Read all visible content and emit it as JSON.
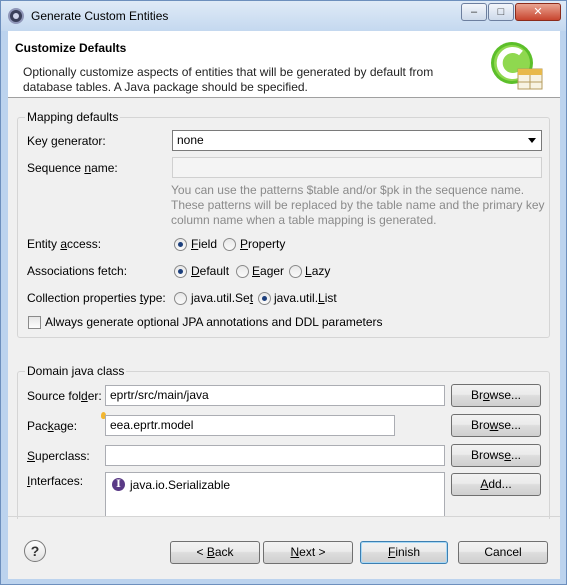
{
  "window": {
    "title": "Generate Custom Entities",
    "controls": {
      "minimize": "–",
      "maximize": "□",
      "close": "✕"
    }
  },
  "banner": {
    "title": "Customize Defaults",
    "description": "Optionally customize aspects of entities that will be generated by default from database tables. A Java package should be specified."
  },
  "mapping": {
    "group_label": "Mapping defaults",
    "key_generator": {
      "label_pre": "Key ",
      "label_u": "g",
      "label_post": "enerator:",
      "value": "none"
    },
    "sequence_name": {
      "label_pre": "Sequence ",
      "label_u": "n",
      "label_post": "ame:",
      "value": ""
    },
    "sequence_hint": "You can use the patterns $table and/or $pk in the sequence name. These patterns will be replaced by the table name and the primary key column name when a table mapping is generated.",
    "entity_access": {
      "label_pre": "Entity ",
      "label_u": "a",
      "label_post": "ccess:",
      "options": [
        {
          "pre": "",
          "u": "F",
          "post": "ield",
          "selected": true
        },
        {
          "pre": "",
          "u": "P",
          "post": "roperty",
          "selected": false
        }
      ]
    },
    "associations_fetch": {
      "label_pre": "Associations fetch:",
      "label_u": "",
      "label_post": "",
      "options": [
        {
          "pre": "",
          "u": "D",
          "post": "efault",
          "selected": true
        },
        {
          "pre": "",
          "u": "E",
          "post": "ager",
          "selected": false
        },
        {
          "pre": "",
          "u": "L",
          "post": "azy",
          "selected": false
        }
      ]
    },
    "collection_type": {
      "label_pre": "Collection properties ",
      "label_u": "t",
      "label_post": "ype:",
      "options": [
        {
          "pre": "java.util.Se",
          "u": "t",
          "post": "",
          "selected": false
        },
        {
          "pre": "java.util.",
          "u": "L",
          "post": "ist",
          "selected": true
        }
      ]
    },
    "always_generate": {
      "label_pre": "Always generate optional JPA annotations and DDL parameters",
      "checked": false
    }
  },
  "domain": {
    "group_label": "Domain java class",
    "source_folder": {
      "label_pre": "Source fol",
      "label_u": "d",
      "label_post": "er:",
      "value": "eprtr/src/main/java",
      "button_pre": "Br",
      "button_u": "o",
      "button_post": "wse..."
    },
    "package": {
      "label_pre": "Pac",
      "label_u": "k",
      "label_post": "age:",
      "value": "eea.eprtr.model",
      "button_pre": "Bro",
      "button_u": "w",
      "button_post": "se..."
    },
    "superclass": {
      "label_pre": "",
      "label_u": "S",
      "label_post": "uperclass:",
      "value": "",
      "button_pre": "Brows",
      "button_u": "e",
      "button_post": "..."
    },
    "interfaces": {
      "label_pre": "",
      "label_u": "I",
      "label_post": "nterfaces:",
      "items": [
        "java.io.Serializable"
      ],
      "button_pre": "",
      "button_u": "A",
      "button_post": "dd..."
    }
  },
  "footer": {
    "help": "?",
    "back": {
      "pre": "< ",
      "u": "B",
      "post": "ack"
    },
    "next": {
      "pre": "",
      "u": "N",
      "post": "ext >"
    },
    "finish": {
      "pre": "",
      "u": "F",
      "post": "inish"
    },
    "cancel": {
      "pre": "Cancel",
      "u": "",
      "post": ""
    }
  },
  "colors": {
    "title_bar": "#c4d8ef",
    "dialog_bg": "#f0f0f0",
    "radio_dot": "#1c3f7c",
    "close_button": "#c8452f"
  }
}
